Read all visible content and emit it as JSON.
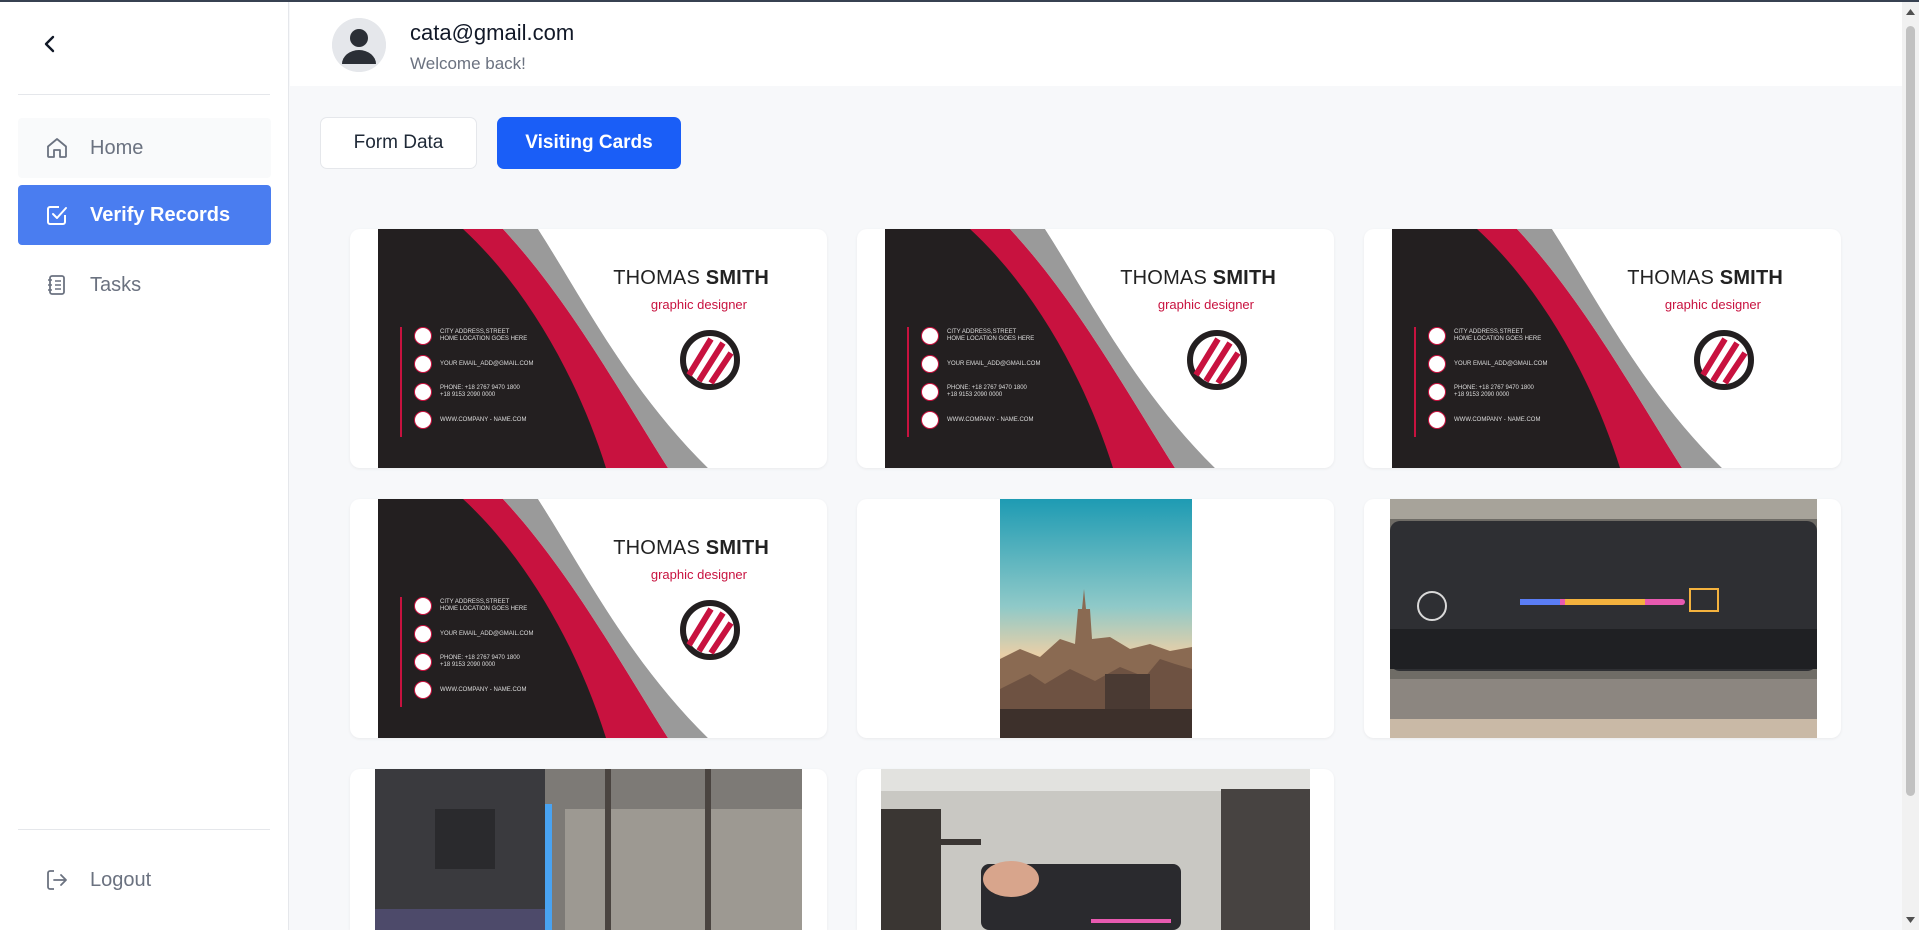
{
  "user": {
    "email": "cata@gmail.com",
    "welcome": "Welcome back!"
  },
  "sidebar": {
    "items": [
      {
        "label": "Home",
        "icon": "home-icon"
      },
      {
        "label": "Verify Records",
        "icon": "check-square-icon"
      },
      {
        "label": "Tasks",
        "icon": "tasks-icon"
      }
    ],
    "logout": "Logout"
  },
  "tabs": [
    {
      "label": "Form Data",
      "active": false
    },
    {
      "label": "Visiting Cards",
      "active": true
    }
  ],
  "business_card": {
    "first_name": "THOMAS",
    "last_name": "SMITH",
    "role": "graphic designer",
    "address": "CITY ADDRESS,STREET",
    "location": "HOME LOCATION GOES HERE",
    "email": "YOUR EMAIL_ADD@GMAIL.COM",
    "phone1": "PHONE: +18 2767 9470 1800",
    "phone2": "+18 9153 2090 0000",
    "web": "WWW.COMPANY - NAME.COM"
  },
  "colors": {
    "accent": "#1a5ef7",
    "sidebar_active": "#4a7df0",
    "card_red": "#c8123f",
    "card_dark": "#231f20"
  }
}
